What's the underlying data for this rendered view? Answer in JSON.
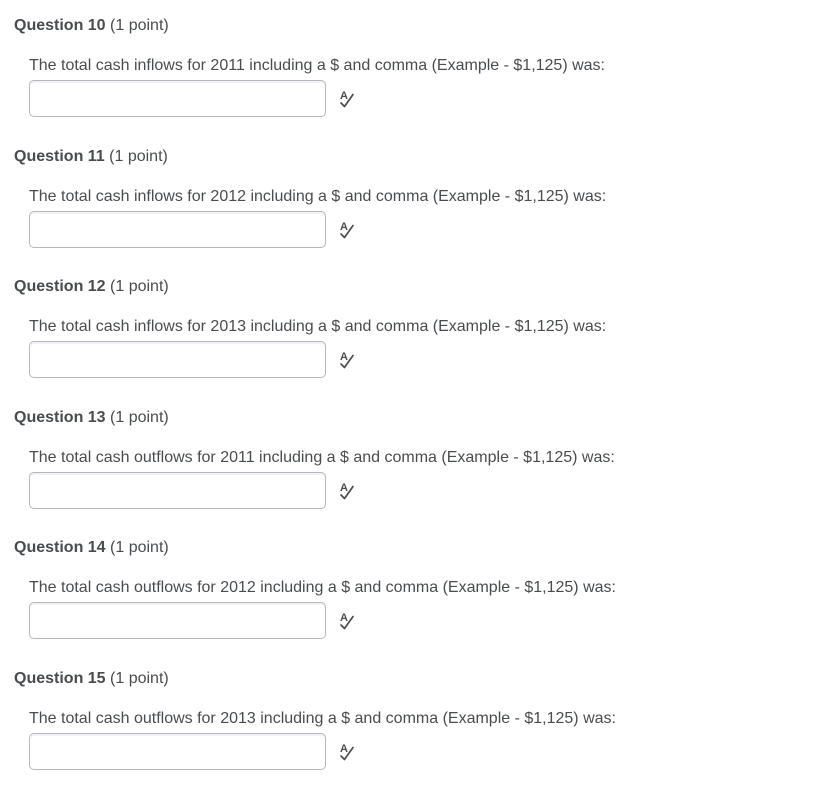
{
  "colors": {
    "text": "#494c4e",
    "input_border": "#b5b7b9",
    "icon": "#494c4e"
  },
  "questions": [
    {
      "title": "Question 10",
      "points": "(1 point)",
      "prompt": "The total cash inflows for 2011 including a $ and comma (Example - $1,125) was:",
      "answer": "",
      "spellcheck_icon": "spell-check-icon"
    },
    {
      "title": "Question 11",
      "points": "(1 point)",
      "prompt": "The total cash inflows for 2012 including a $ and comma (Example - $1,125) was:",
      "answer": "",
      "spellcheck_icon": "spell-check-icon"
    },
    {
      "title": "Question 12",
      "points": "(1 point)",
      "prompt": "The total cash inflows for 2013 including a $ and comma (Example - $1,125) was:",
      "answer": "",
      "spellcheck_icon": "spell-check-icon"
    },
    {
      "title": "Question 13",
      "points": "(1 point)",
      "prompt": "The total cash outflows for 2011 including a $ and comma (Example - $1,125) was:",
      "answer": "",
      "spellcheck_icon": "spell-check-icon"
    },
    {
      "title": "Question 14",
      "points": "(1 point)",
      "prompt": "The total cash outflows for 2012 including a $ and comma (Example - $1,125) was:",
      "answer": "",
      "spellcheck_icon": "spell-check-icon"
    },
    {
      "title": "Question 15",
      "points": "(1 point)",
      "prompt": "The total cash outflows for 2013 including a $ and comma (Example - $1,125) was:",
      "answer": "",
      "spellcheck_icon": "spell-check-icon"
    }
  ]
}
